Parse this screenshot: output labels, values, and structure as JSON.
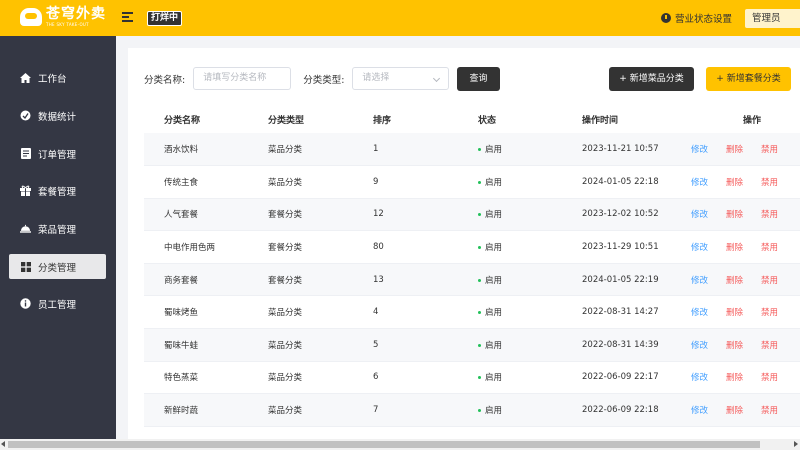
{
  "header": {
    "logo_title": "苍穹外卖",
    "logo_subtitle": "THE SKY TAKE-OUT",
    "shop_status": "打烊中",
    "shop_settings": "营业状态设置",
    "user": "管理员"
  },
  "sidebar": {
    "items": [
      {
        "label": "工作台",
        "icon": "home-icon"
      },
      {
        "label": "数据统计",
        "icon": "chart-icon"
      },
      {
        "label": "订单管理",
        "icon": "order-icon"
      },
      {
        "label": "套餐管理",
        "icon": "gift-icon"
      },
      {
        "label": "菜品管理",
        "icon": "dish-icon"
      },
      {
        "label": "分类管理",
        "icon": "grid-icon",
        "active": true
      },
      {
        "label": "员工管理",
        "icon": "info-icon"
      }
    ]
  },
  "filter": {
    "name_label": "分类名称:",
    "name_placeholder": "请填写分类名称",
    "type_label": "分类类型:",
    "type_placeholder": "请选择",
    "query_button": "查询",
    "add_dish_button": "+ 新增菜品分类",
    "add_combo_button": "+ 新增套餐分类"
  },
  "table": {
    "columns": [
      "分类名称",
      "分类类型",
      "排序",
      "状态",
      "操作时间",
      "操作"
    ],
    "action_edit": "修改",
    "action_delete": "删除",
    "action_disable": "禁用",
    "rows": [
      {
        "name": "酒水饮料",
        "type": "菜品分类",
        "sort": "1",
        "status": "启用",
        "time": "2023-11-21 10:57"
      },
      {
        "name": "传统主食",
        "type": "菜品分类",
        "sort": "9",
        "status": "启用",
        "time": "2024-01-05 22:18"
      },
      {
        "name": "人气套餐",
        "type": "套餐分类",
        "sort": "12",
        "status": "启用",
        "time": "2023-12-02 10:52"
      },
      {
        "name": "中电作用色两",
        "type": "套餐分类",
        "sort": "80",
        "status": "启用",
        "time": "2023-11-29 10:51"
      },
      {
        "name": "商务套餐",
        "type": "套餐分类",
        "sort": "13",
        "status": "启用",
        "time": "2024-01-05 22:19"
      },
      {
        "name": "蜀味烤鱼",
        "type": "菜品分类",
        "sort": "4",
        "status": "启用",
        "time": "2022-08-31 14:27"
      },
      {
        "name": "蜀味牛蛙",
        "type": "菜品分类",
        "sort": "5",
        "status": "启用",
        "time": "2022-08-31 14:39"
      },
      {
        "name": "特色蒸菜",
        "type": "菜品分类",
        "sort": "6",
        "status": "启用",
        "time": "2022-06-09 22:17"
      },
      {
        "name": "新鲜时蔬",
        "type": "菜品分类",
        "sort": "7",
        "status": "启用",
        "time": "2022-06-09 22:18"
      }
    ]
  },
  "colors": {
    "accent": "#ffc200",
    "sidebar": "#343744",
    "edit": "#419eff",
    "danger": "#f55b5b",
    "status_on": "#22c05a"
  }
}
